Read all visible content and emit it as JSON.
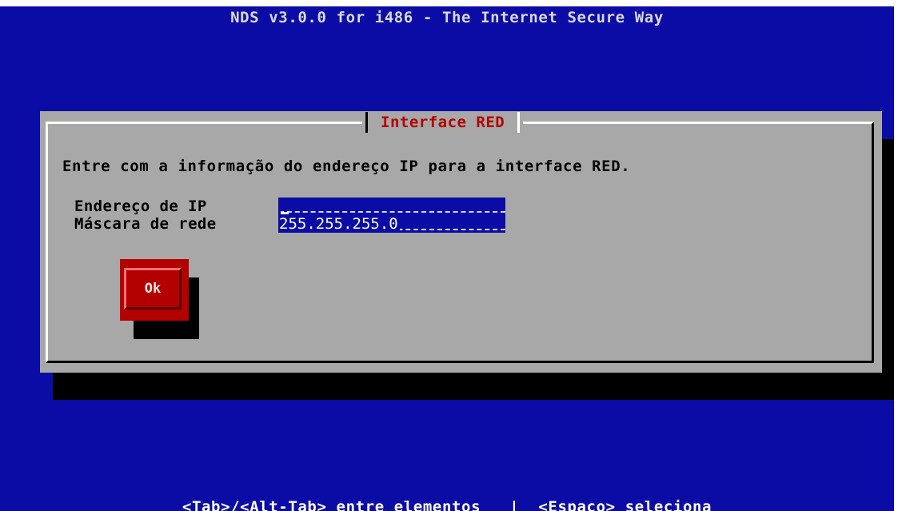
{
  "window": {
    "title": "NDS v3.0.0 for i486 - The Internet Secure Way"
  },
  "dialog": {
    "title": "Interface RED",
    "instruction": "Entre com a informação do endereço IP para a interface RED.",
    "fields": [
      {
        "label": "Endereço de IP",
        "value": "",
        "max_length": 20
      },
      {
        "label": "Máscara de rede",
        "value": "255.255.255.0",
        "max_length": 20
      }
    ],
    "ok_label": "Ok"
  },
  "help": {
    "text": "<Tab>/<Alt-Tab> entre elementos   |  <Espaço> seleciona"
  },
  "colors": {
    "background": "#0b0ba6",
    "dialog": "#a8a8a8",
    "title_accent": "#b30000",
    "button": "#b30000",
    "field": "#0b0ba6"
  }
}
